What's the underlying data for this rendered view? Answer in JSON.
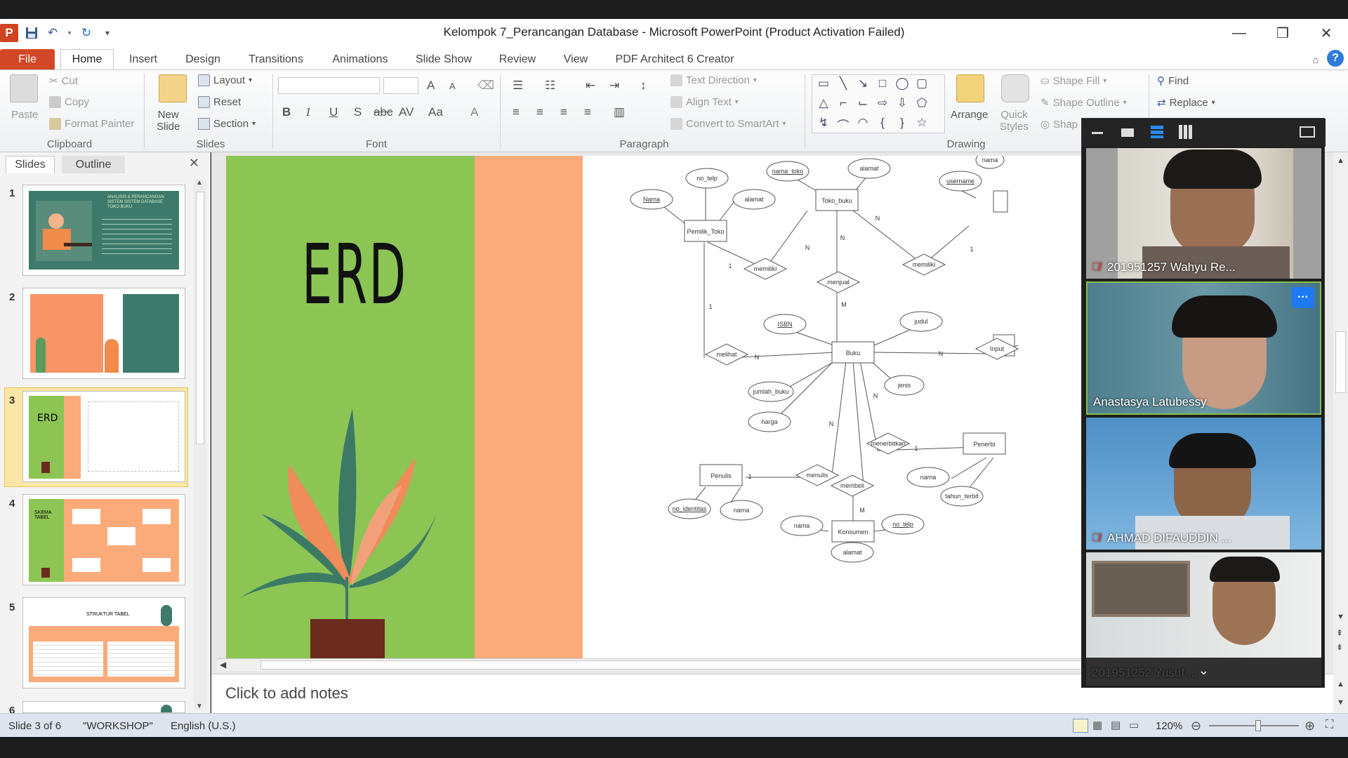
{
  "window": {
    "title": "Kelompok 7_Perancangan Database  -  Microsoft PowerPoint (Product Activation Failed)",
    "app_badge": "P",
    "minimize": "—",
    "restore": "❐",
    "close": "✕"
  },
  "tabs": [
    "File",
    "Home",
    "Insert",
    "Design",
    "Transitions",
    "Animations",
    "Slide Show",
    "Review",
    "View",
    "PDF Architect 6 Creator"
  ],
  "ribbon": {
    "clipboard": {
      "paste": "Paste",
      "cut": "Cut",
      "copy": "Copy",
      "format_painter": "Format Painter",
      "label": "Clipboard"
    },
    "slides": {
      "new_slide": "New",
      "new_slide2": "Slide",
      "layout": "Layout",
      "reset": "Reset",
      "section": "Section",
      "label": "Slides"
    },
    "font": {
      "label": "Font",
      "bold": "B",
      "italic": "I",
      "underline": "U",
      "shadow": "S",
      "strike": "abc",
      "spacing": "AV",
      "case": "Aa",
      "color": "A",
      "grow": "A",
      "shrink": "A"
    },
    "paragraph": {
      "text_direction": "Text Direction",
      "align_text": "Align Text",
      "smartart": "Convert to SmartArt",
      "label": "Paragraph"
    },
    "drawing": {
      "arrange": "Arrange",
      "quick_styles": "Quick",
      "quick_styles2": "Styles",
      "shape_fill": "Shape Fill",
      "shape_outline": "Shape Outline",
      "shape_effects": "Shap",
      "label": "Drawing"
    },
    "editing": {
      "find": "Find",
      "replace": "Replace"
    }
  },
  "left_pane": {
    "tab_slides": "Slides",
    "tab_outline": "Outline",
    "close": "✕",
    "slide_numbers": [
      "1",
      "2",
      "3",
      "4",
      "5",
      "6"
    ],
    "thumb1_title": "ANALISIS & PERANCANGAN SISTEM SISTEM DATABASE TOKO BUKU",
    "thumb4_title": "SKEMA TABEL",
    "thumb5_title": "STRUKTUR TABEL"
  },
  "slide": {
    "title": "ERD",
    "erd": {
      "entities": [
        "Pemilik_Toko",
        "Toko_buku",
        "Buku",
        "Penulis",
        "Konsumen",
        "Penerbi",
        "Input"
      ],
      "relations": [
        "memiliki",
        "menjual",
        "memiliki",
        "melihat",
        "menulis",
        "membeli",
        "menerbitkan"
      ],
      "attributes": [
        "Nama",
        "no_telp",
        "alamat",
        "nama_toko",
        "alamat",
        "username",
        "nama",
        "ISBN",
        "judul",
        "jumlah_buku",
        "jenis",
        "harga",
        "no_identitas",
        "nama",
        "nama",
        "no_telp",
        "alamat",
        "nama",
        "tahun_terbit"
      ],
      "cardinalities": [
        "1",
        "N",
        "N",
        "1",
        "M",
        "1",
        "N",
        "N",
        "N",
        "N",
        "1",
        "1",
        "N",
        "M"
      ]
    }
  },
  "notes": {
    "placeholder": "Click to add notes"
  },
  "status": {
    "slide_info": "Slide 3 of 6",
    "theme": "\"WORKSHOP\"",
    "language": "English (U.S.)",
    "zoom": "120%",
    "zoom_level": 0.55
  },
  "meeting": {
    "participants": [
      {
        "name": "201951257 Wahyu Re...",
        "muted": true
      },
      {
        "name": "Anastasya Latubessy",
        "muted": false,
        "active": true
      },
      {
        "name": "AHMAD DIFAUDDIN ...",
        "muted": true
      },
      {
        "name": "201951252 Yusuf ...",
        "muted": false
      }
    ],
    "more": "···"
  },
  "colors": {
    "accent_red": "#d24726",
    "slide_green": "#8dc555",
    "slide_peach": "#fbaa7a",
    "zoom_active_border": "#86c045",
    "meeting_blue": "#1f79f2"
  }
}
